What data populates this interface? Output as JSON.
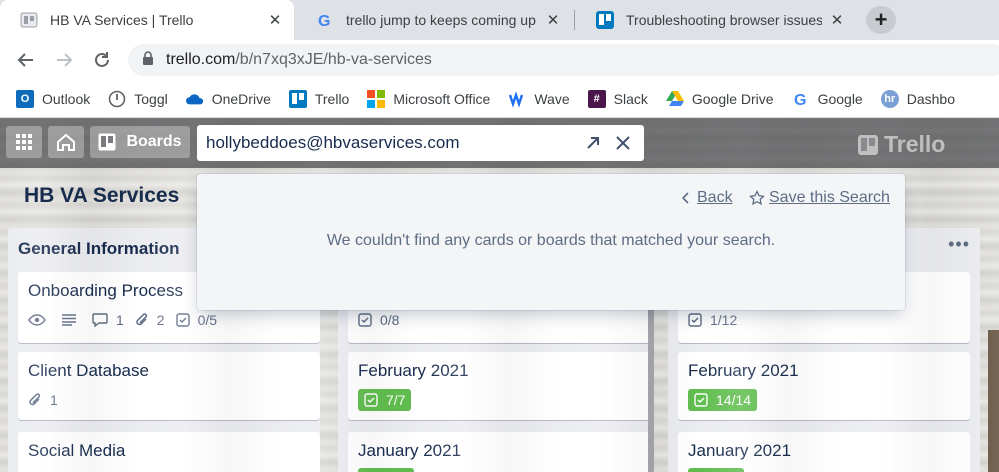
{
  "browser": {
    "tabs": [
      {
        "title": "HB VA Services | Trello",
        "active": true
      },
      {
        "title": "trello jump to keeps coming up - G",
        "active": false
      },
      {
        "title": "Troubleshooting browser issues",
        "active": false
      }
    ],
    "address": {
      "host": "trello.com",
      "path": "/b/n7xq3xJE/hb-va-services"
    },
    "bookmarks": [
      {
        "label": "Outlook",
        "icon": "outlook-icon",
        "color": "#0f6cbd"
      },
      {
        "label": "Toggl",
        "icon": "toggl-icon",
        "color": "#5f6368"
      },
      {
        "label": "OneDrive",
        "icon": "onedrive-icon",
        "color": "#0a66c2"
      },
      {
        "label": "Trello",
        "icon": "trello-icon",
        "color": "#0079bf"
      },
      {
        "label": "Microsoft Office",
        "icon": "microsoft-office-icon",
        "color": "#f25022"
      },
      {
        "label": "Wave",
        "icon": "wave-icon",
        "color": "#1c6ef2"
      },
      {
        "label": "Slack",
        "icon": "slack-icon",
        "color": "#4a154b"
      },
      {
        "label": "Google Drive",
        "icon": "google-drive-icon",
        "color": "#34a853"
      },
      {
        "label": "Google",
        "icon": "google-icon",
        "color": "#4285f4"
      },
      {
        "label": "Dashbo",
        "icon": "dashboard-icon",
        "color": "#7aa0d4"
      }
    ]
  },
  "trello": {
    "header": {
      "boards_label": "Boards",
      "search_value": "hollybeddoes@hbvaservices.com",
      "logo_text": "Trello"
    },
    "board_title": "HB VA Services",
    "search_popover": {
      "back_label": "Back",
      "save_label": "Save this Search",
      "empty_message": "We couldn't find any cards or boards that matched your search."
    },
    "lists": [
      {
        "title": "General Information",
        "cards": [
          {
            "title": "Onboarding Process",
            "badges": {
              "comments": "1",
              "attachments": "2",
              "checklist": "0/5"
            }
          },
          {
            "title": "Client Database",
            "badges": {
              "attachments": "1"
            }
          },
          {
            "title": "Social Media"
          }
        ]
      },
      {
        "title": "",
        "cards": [
          {
            "title": "",
            "badges": {
              "checklist": "0/8"
            }
          },
          {
            "title": "February 2021",
            "badges": {
              "checklist_done": "7/7"
            }
          },
          {
            "title": "January 2021"
          }
        ]
      },
      {
        "title": "",
        "cards": [
          {
            "title": "",
            "badges": {
              "checklist": "1/12"
            }
          },
          {
            "title": "February 2021",
            "badges": {
              "checklist_done": "14/14"
            }
          },
          {
            "title": "January 2021"
          }
        ]
      }
    ],
    "colors": {
      "accent_green": "#61bd4f",
      "text_primary": "#172b4d",
      "text_muted": "#5e6c84"
    }
  }
}
